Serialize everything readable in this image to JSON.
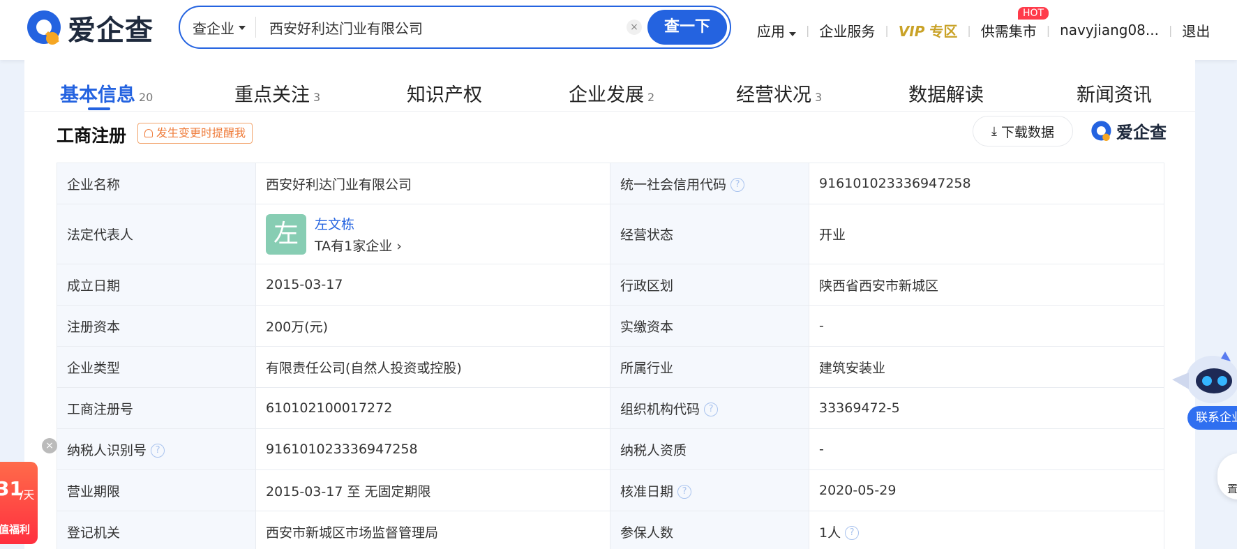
{
  "header": {
    "logo_text": "爱企查",
    "search": {
      "type_label": "查企业",
      "value": "西安好利达门业有限公司",
      "clear_symbol": "×",
      "button_label": "查一下"
    },
    "nav": {
      "apps": "应用",
      "enterprise_service": "企业服务",
      "vip_mark": "VIP",
      "vip_zone": "专区",
      "supply_demand": "供需集市",
      "hot_badge": "HOT",
      "username": "navyjiang08...",
      "logout": "退出"
    }
  },
  "tabs": [
    {
      "label": "基本信息",
      "count": "20",
      "active": true
    },
    {
      "label": "重点关注",
      "count": "3"
    },
    {
      "label": "知识产权",
      "count": ""
    },
    {
      "label": "企业发展",
      "count": "2"
    },
    {
      "label": "经营状况",
      "count": "3"
    },
    {
      "label": "数据解读",
      "count": ""
    },
    {
      "label": "新闻资讯",
      "count": ""
    }
  ],
  "section": {
    "title": "工商注册",
    "remind_label": "发生变更时提醒我",
    "download_label": "下载数据",
    "watermark_text": "爱企查"
  },
  "table": {
    "company_name_label": "企业名称",
    "company_name": "西安好利达门业有限公司",
    "credit_code_label": "统一社会信用代码",
    "credit_code": "916101023336947258",
    "legal_rep_label": "法定代表人",
    "legal_rep_avatar": "左",
    "legal_rep_name": "左文栋",
    "legal_rep_companies": "TA有1家企业",
    "status_label": "经营状态",
    "status": "开业",
    "founded_label": "成立日期",
    "founded": "2015-03-17",
    "region_label": "行政区划",
    "region": "陕西省西安市新城区",
    "reg_capital_label": "注册资本",
    "reg_capital": "200万(元)",
    "paid_capital_label": "实缴资本",
    "paid_capital": "-",
    "type_label": "企业类型",
    "type": "有限责任公司(自然人投资或控股)",
    "industry_label": "所属行业",
    "industry": "建筑安装业",
    "reg_no_label": "工商注册号",
    "reg_no": "610102100017272",
    "org_code_label": "组织机构代码",
    "org_code": "33369472-5",
    "taxpayer_id_label": "纳税人识别号",
    "taxpayer_id": "916101023336947258",
    "taxpayer_qual_label": "纳税人资质",
    "taxpayer_qual": "-",
    "term_label": "营业期限",
    "term": "2015-03-17 至 无固定期限",
    "approval_label": "核准日期",
    "approval": "2020-05-29",
    "authority_label": "登记机关",
    "authority": "西安市新城区市场监督管理局",
    "insured_label": "参保人数",
    "insured": "1人"
  },
  "floating": {
    "promo_num": "31",
    "promo_unit": "/天",
    "promo_label": "值福利",
    "close_symbol": "×",
    "contact_label": "联系企业",
    "side_label": "置"
  },
  "colors": {
    "accent": "#2463e0",
    "vip": "#c9a227",
    "remind": "#ef7d3c",
    "hot": "#ff3b4a",
    "avatar": "#87cdb3"
  }
}
